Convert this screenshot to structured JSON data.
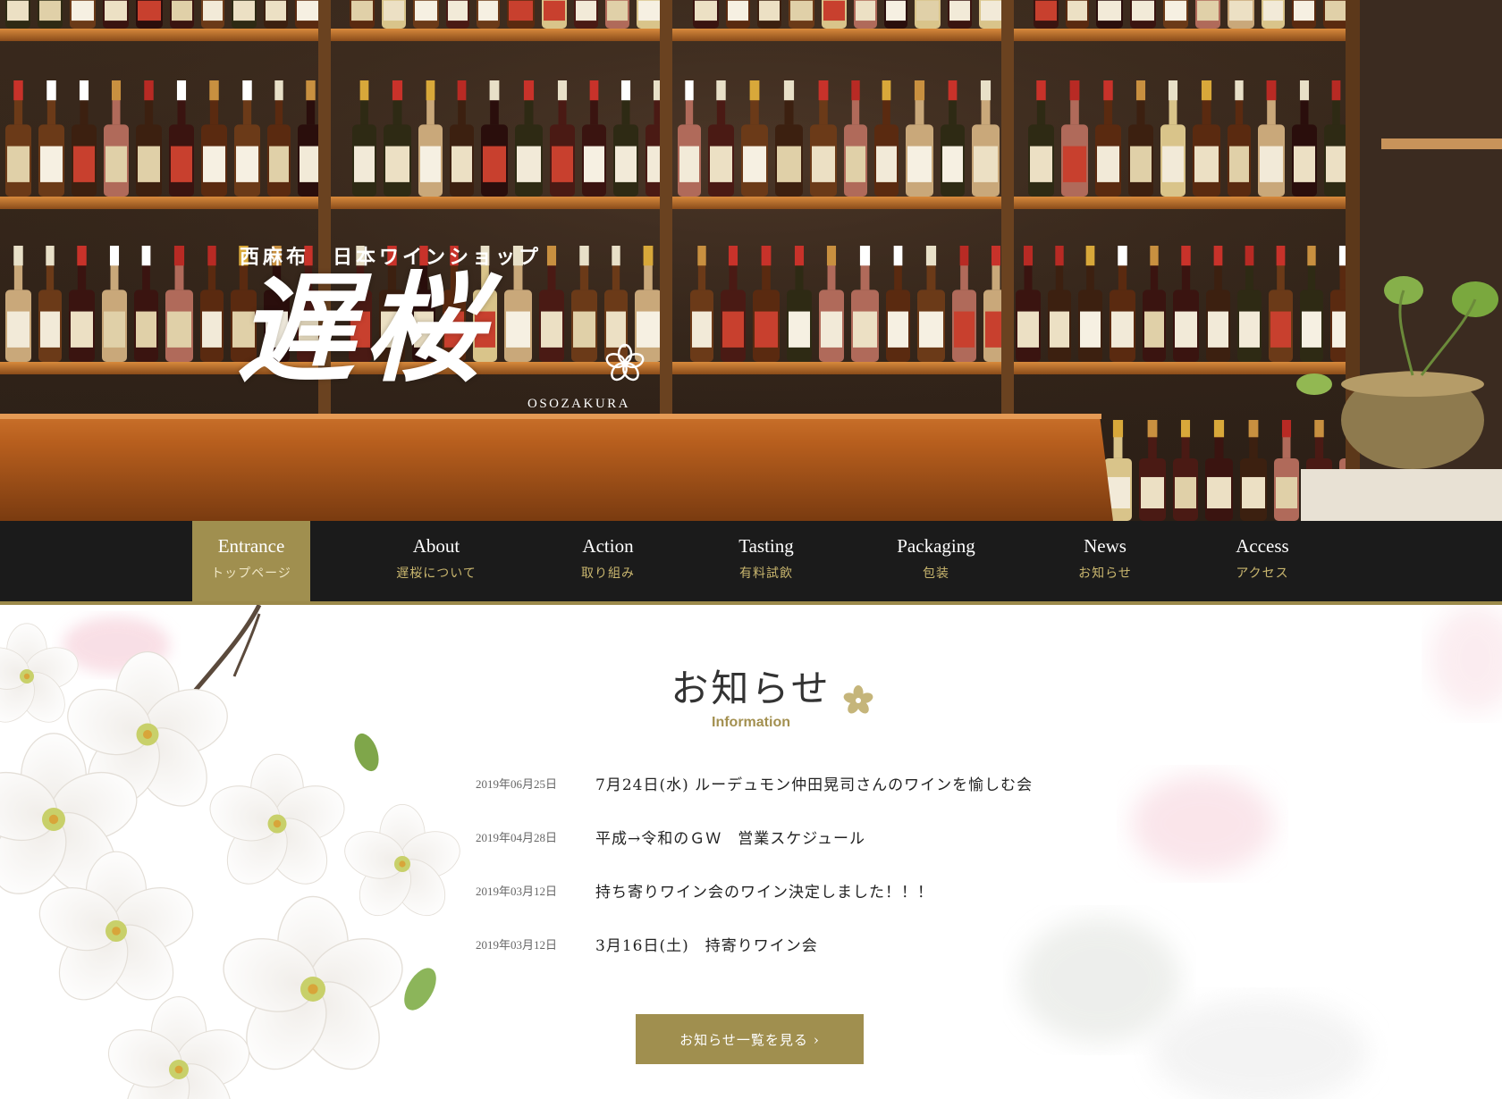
{
  "site": {
    "logo_subtitle": "西麻布　日本ワインショップ",
    "logo_name": "遅桜",
    "logo_roman": "OSOZAKURA"
  },
  "nav": {
    "items": [
      {
        "en": "Entrance",
        "jp": "トップページ",
        "active": true
      },
      {
        "en": "About",
        "jp": "遅桜について",
        "active": false
      },
      {
        "en": "Action",
        "jp": "取り組み",
        "active": false
      },
      {
        "en": "Tasting",
        "jp": "有料試飲",
        "active": false
      },
      {
        "en": "Packaging",
        "jp": "包装",
        "active": false
      },
      {
        "en": "News",
        "jp": "お知らせ",
        "active": false
      },
      {
        "en": "Access",
        "jp": "アクセス",
        "active": false
      }
    ]
  },
  "news": {
    "title_jp": "お知らせ",
    "title_en": "Information",
    "items": [
      {
        "date": "2019年06月25日",
        "title": "7月24日(水) ルーデュモン仲田晃司さんのワインを愉しむ会"
      },
      {
        "date": "2019年04月28日",
        "title": "平成→令和のＧＷ　営業スケジュール"
      },
      {
        "date": "2019年03月12日",
        "title": "持ち寄りワイン会のワイン決定しました！！！"
      },
      {
        "date": "2019年03月12日",
        "title": "3月16日(土)　持寄りワイン会"
      }
    ],
    "more_label": "お知らせ一覧を見る",
    "more_icon": "chevron-right-icon"
  },
  "colors": {
    "accent": "#a08f4f",
    "nav_bg": "#1b1b1b",
    "nav_jp_text": "#c9b66e"
  }
}
